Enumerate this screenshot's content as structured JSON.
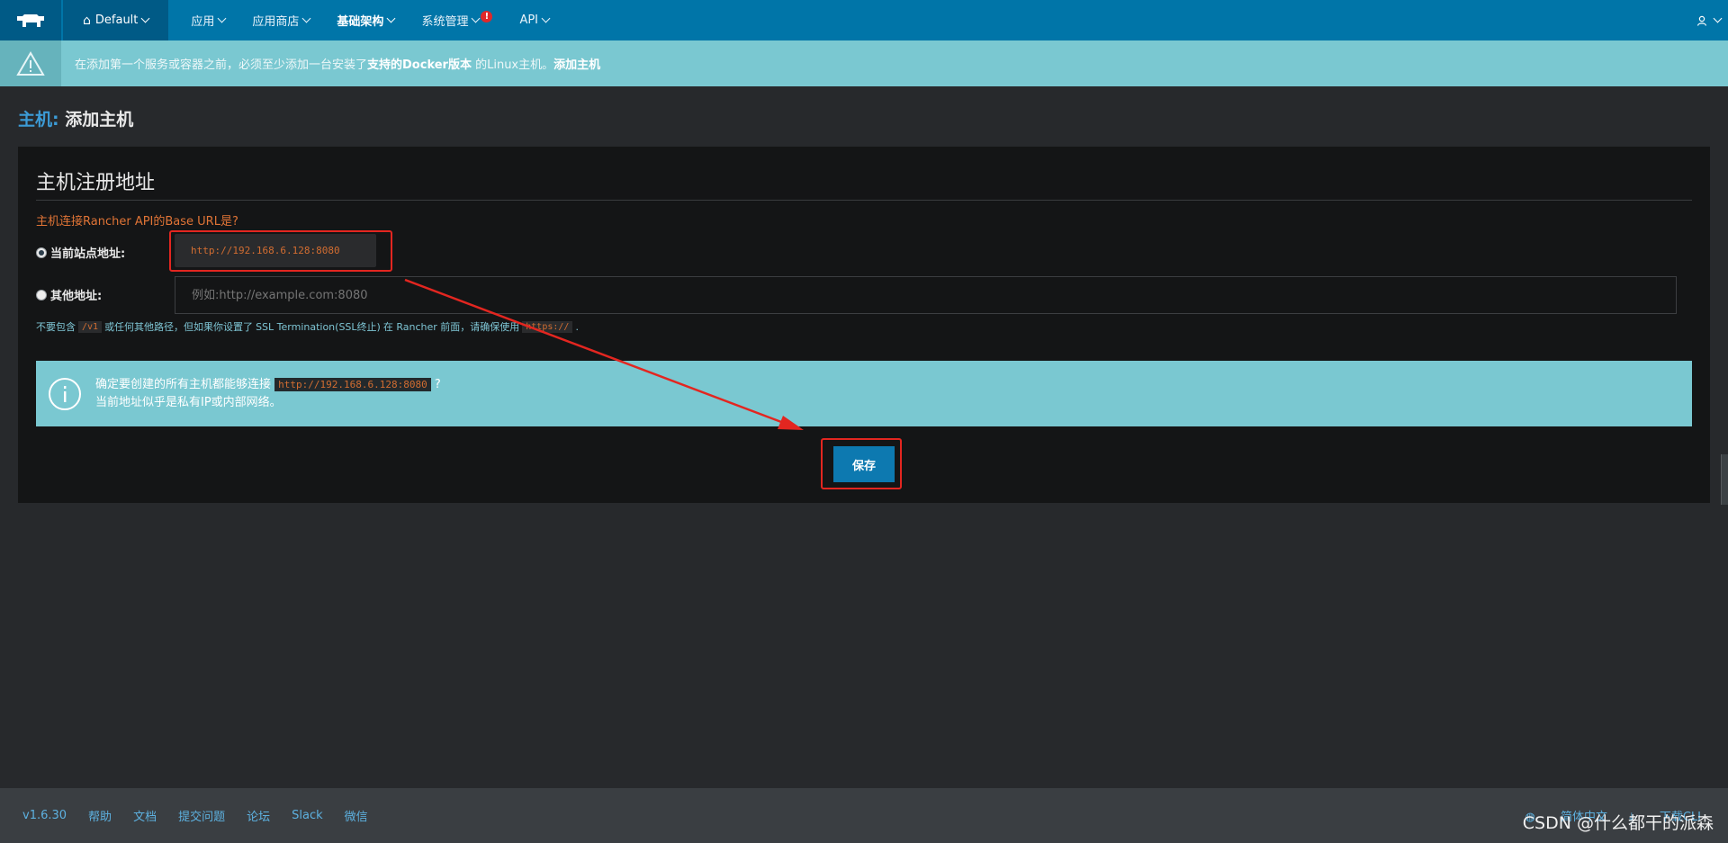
{
  "nav": {
    "env": "Default",
    "items": [
      {
        "label": "应用",
        "active": false
      },
      {
        "label": "应用商店",
        "active": false
      },
      {
        "label": "基础架构",
        "active": true
      },
      {
        "label": "系统管理",
        "active": false,
        "alert": "!"
      },
      {
        "label": "API",
        "active": false
      }
    ]
  },
  "warning": {
    "text_pre": "在添加第一个服务或容器之前，必须至少添加一台安装了",
    "link1": "支持的Docker版本",
    "text_mid": " 的Linux主机。",
    "link2": "添加主机"
  },
  "page": {
    "title_prefix": "主机:",
    "title": " 添加主机"
  },
  "card": {
    "title": "主机注册地址",
    "question": "主机连接Rancher API的Base URL是?",
    "option_current_label": "当前站点地址:",
    "option_current_value": "http://192.168.6.128:8080",
    "option_other_label": "其他地址:",
    "option_other_placeholder": "例如:http://example.com:8080",
    "hint_pre": "不要包含",
    "hint_code1": "/v1",
    "hint_mid": "或任何其他路径，但如果你设置了",
    "hint_link": "SSL Termination(SSL终止)",
    "hint_mid2": "在 Rancher 前面，请确保使用",
    "hint_code2": "https://",
    "hint_end": ".",
    "info_line1_pre": "确定要创建的所有主机都能够连接",
    "info_code": "http://192.168.6.128:8080",
    "info_line1_post": "?",
    "info_line2": "当前地址似乎是私有IP或内部网络。",
    "save_label": "保存"
  },
  "footer": {
    "links": [
      "v1.6.30",
      "帮助",
      "文档",
      "提交问题",
      "论坛",
      "Slack",
      "微信"
    ],
    "language": "简体中文",
    "download": "下载CLI",
    "watermark": "CSDN @什么都干的派森"
  },
  "colors": {
    "nav_bg": "#0075a8",
    "warning_bg": "#7ac8d1",
    "page_bg": "#27292c",
    "card_bg": "#141516",
    "accent_orange": "#d26d31",
    "annotation_red": "#e32620",
    "save_button": "#0d79b0"
  }
}
